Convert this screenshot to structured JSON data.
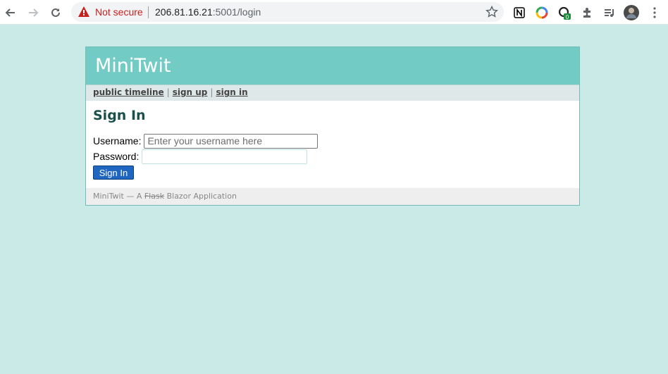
{
  "browser": {
    "security_label": "Not secure",
    "url_host": "206.81.16.21",
    "url_rest": ":5001/login",
    "icons": [
      "back-arrow-icon",
      "forward-arrow-icon",
      "reload-icon",
      "warning-icon",
      "star-icon",
      "notion-icon",
      "color-wheel-icon",
      "extension-badge-icon",
      "puzzle-icon",
      "media-queue-icon",
      "avatar",
      "menu-kebab-icon"
    ],
    "extension_badge": "0"
  },
  "site": {
    "title": "MiniTwit"
  },
  "nav": {
    "public_timeline": "public timeline",
    "sign_up": "sign up",
    "sign_in": "sign in",
    "separator": "|"
  },
  "form": {
    "heading": "Sign In",
    "username_label": "Username:",
    "username_placeholder": "Enter your username here",
    "password_label": "Password:",
    "submit_label": "Sign In"
  },
  "footer": {
    "prefix": "MiniTwit — A ",
    "struck": "Flask",
    "suffix": " Blazor Application"
  },
  "colors": {
    "page_bg": "#c9eae7",
    "header_bg": "#72ccc5",
    "heading_text": "#1a4f4b",
    "button_bg": "#1e66c0",
    "insecure_text": "#c5221f"
  }
}
